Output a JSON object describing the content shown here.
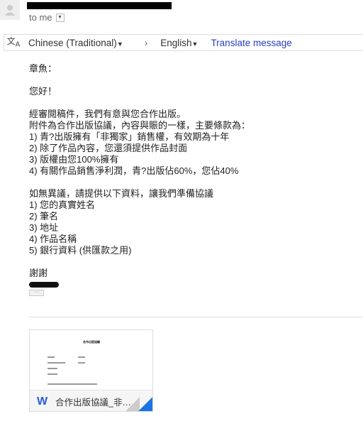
{
  "header": {
    "recipient_label": "to me"
  },
  "translate_bar": {
    "source_language": "Chinese (Traditional)",
    "target_language": "English",
    "translate_link": "Translate message"
  },
  "message": {
    "lines": [
      "章魚：",
      "",
      "您好！",
      "",
      "經審閱稿件，我們有意與您合作出版。",
      "附件為合作出版協議，內容與賑的一樣，主要條款為：",
      "1) 青?出版擁有「非獨家」銷售權，有效期為十年",
      "2) 除了作品內容，您還須提供作品封面",
      "3) 版權由您100%擁有",
      "4) 有關作品銷售淨利潤，青?出版佔60%，您佔40%",
      "",
      "如無異議，請提供以下資料，讓我們準備協議",
      "1) 您的真實姓名",
      "2) 筆名",
      "3) 地址",
      "4) 作品名稱",
      "5) 銀行資料 (供匯款之用)",
      "",
      "謝謝"
    ],
    "more_button": "···"
  },
  "attachment": {
    "preview_title": "合作出版協議",
    "file_name": "合作出版協議_非…",
    "file_type_icon": "word-icon",
    "accent_color": "#2a5bd7"
  }
}
